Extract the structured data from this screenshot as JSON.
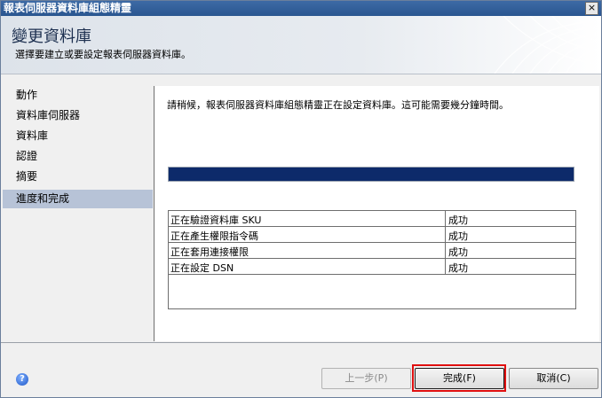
{
  "window": {
    "title": "報表伺服器資料庫組態精靈",
    "close_glyph": "×"
  },
  "header": {
    "title": "變更資料庫",
    "subtitle": "選擇要建立或要設定報表伺服器資料庫。"
  },
  "sidebar": {
    "items": [
      {
        "label": "動作",
        "selected": false
      },
      {
        "label": "資料庫伺服器",
        "selected": false
      },
      {
        "label": "資料庫",
        "selected": false
      },
      {
        "label": "認證",
        "selected": false
      },
      {
        "label": "摘要",
        "selected": false
      },
      {
        "label": "進度和完成",
        "selected": true
      }
    ]
  },
  "content": {
    "message": "請稍候，報表伺服器資料庫組態精靈正在設定資料庫。這可能需要幾分鐘時間。",
    "progress_fraction": 1.0,
    "tasks": [
      {
        "task": "正在驗證資料庫 SKU",
        "result": "成功"
      },
      {
        "task": "正在產生權限指令碼",
        "result": "成功"
      },
      {
        "task": "正在套用連接權限",
        "result": "成功"
      },
      {
        "task": "正在設定 DSN",
        "result": "成功"
      }
    ]
  },
  "footer": {
    "help_icon": "help-icon",
    "help_glyph": "?",
    "back_label": "上一步(P)",
    "finish_label": "完成(F)",
    "cancel_label": "取消(C)"
  },
  "colors": {
    "titlebar": "#2f5c99",
    "progress_fill": "#0d2a6a",
    "selected_item": "#b7c3d7",
    "highlight_box": "#e01010"
  }
}
